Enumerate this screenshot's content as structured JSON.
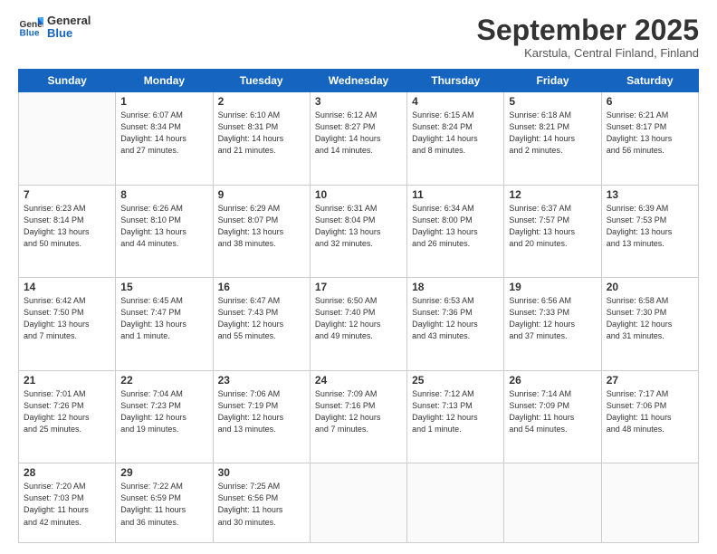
{
  "logo": {
    "general": "General",
    "blue": "Blue"
  },
  "header": {
    "title": "September 2025",
    "subtitle": "Karstula, Central Finland, Finland"
  },
  "weekdays": [
    "Sunday",
    "Monday",
    "Tuesday",
    "Wednesday",
    "Thursday",
    "Friday",
    "Saturday"
  ],
  "weeks": [
    [
      {
        "day": "",
        "text": ""
      },
      {
        "day": "1",
        "text": "Sunrise: 6:07 AM\nSunset: 8:34 PM\nDaylight: 14 hours\nand 27 minutes."
      },
      {
        "day": "2",
        "text": "Sunrise: 6:10 AM\nSunset: 8:31 PM\nDaylight: 14 hours\nand 21 minutes."
      },
      {
        "day": "3",
        "text": "Sunrise: 6:12 AM\nSunset: 8:27 PM\nDaylight: 14 hours\nand 14 minutes."
      },
      {
        "day": "4",
        "text": "Sunrise: 6:15 AM\nSunset: 8:24 PM\nDaylight: 14 hours\nand 8 minutes."
      },
      {
        "day": "5",
        "text": "Sunrise: 6:18 AM\nSunset: 8:21 PM\nDaylight: 14 hours\nand 2 minutes."
      },
      {
        "day": "6",
        "text": "Sunrise: 6:21 AM\nSunset: 8:17 PM\nDaylight: 13 hours\nand 56 minutes."
      }
    ],
    [
      {
        "day": "7",
        "text": "Sunrise: 6:23 AM\nSunset: 8:14 PM\nDaylight: 13 hours\nand 50 minutes."
      },
      {
        "day": "8",
        "text": "Sunrise: 6:26 AM\nSunset: 8:10 PM\nDaylight: 13 hours\nand 44 minutes."
      },
      {
        "day": "9",
        "text": "Sunrise: 6:29 AM\nSunset: 8:07 PM\nDaylight: 13 hours\nand 38 minutes."
      },
      {
        "day": "10",
        "text": "Sunrise: 6:31 AM\nSunset: 8:04 PM\nDaylight: 13 hours\nand 32 minutes."
      },
      {
        "day": "11",
        "text": "Sunrise: 6:34 AM\nSunset: 8:00 PM\nDaylight: 13 hours\nand 26 minutes."
      },
      {
        "day": "12",
        "text": "Sunrise: 6:37 AM\nSunset: 7:57 PM\nDaylight: 13 hours\nand 20 minutes."
      },
      {
        "day": "13",
        "text": "Sunrise: 6:39 AM\nSunset: 7:53 PM\nDaylight: 13 hours\nand 13 minutes."
      }
    ],
    [
      {
        "day": "14",
        "text": "Sunrise: 6:42 AM\nSunset: 7:50 PM\nDaylight: 13 hours\nand 7 minutes."
      },
      {
        "day": "15",
        "text": "Sunrise: 6:45 AM\nSunset: 7:47 PM\nDaylight: 13 hours\nand 1 minute."
      },
      {
        "day": "16",
        "text": "Sunrise: 6:47 AM\nSunset: 7:43 PM\nDaylight: 12 hours\nand 55 minutes."
      },
      {
        "day": "17",
        "text": "Sunrise: 6:50 AM\nSunset: 7:40 PM\nDaylight: 12 hours\nand 49 minutes."
      },
      {
        "day": "18",
        "text": "Sunrise: 6:53 AM\nSunset: 7:36 PM\nDaylight: 12 hours\nand 43 minutes."
      },
      {
        "day": "19",
        "text": "Sunrise: 6:56 AM\nSunset: 7:33 PM\nDaylight: 12 hours\nand 37 minutes."
      },
      {
        "day": "20",
        "text": "Sunrise: 6:58 AM\nSunset: 7:30 PM\nDaylight: 12 hours\nand 31 minutes."
      }
    ],
    [
      {
        "day": "21",
        "text": "Sunrise: 7:01 AM\nSunset: 7:26 PM\nDaylight: 12 hours\nand 25 minutes."
      },
      {
        "day": "22",
        "text": "Sunrise: 7:04 AM\nSunset: 7:23 PM\nDaylight: 12 hours\nand 19 minutes."
      },
      {
        "day": "23",
        "text": "Sunrise: 7:06 AM\nSunset: 7:19 PM\nDaylight: 12 hours\nand 13 minutes."
      },
      {
        "day": "24",
        "text": "Sunrise: 7:09 AM\nSunset: 7:16 PM\nDaylight: 12 hours\nand 7 minutes."
      },
      {
        "day": "25",
        "text": "Sunrise: 7:12 AM\nSunset: 7:13 PM\nDaylight: 12 hours\nand 1 minute."
      },
      {
        "day": "26",
        "text": "Sunrise: 7:14 AM\nSunset: 7:09 PM\nDaylight: 11 hours\nand 54 minutes."
      },
      {
        "day": "27",
        "text": "Sunrise: 7:17 AM\nSunset: 7:06 PM\nDaylight: 11 hours\nand 48 minutes."
      }
    ],
    [
      {
        "day": "28",
        "text": "Sunrise: 7:20 AM\nSunset: 7:03 PM\nDaylight: 11 hours\nand 42 minutes."
      },
      {
        "day": "29",
        "text": "Sunrise: 7:22 AM\nSunset: 6:59 PM\nDaylight: 11 hours\nand 36 minutes."
      },
      {
        "day": "30",
        "text": "Sunrise: 7:25 AM\nSunset: 6:56 PM\nDaylight: 11 hours\nand 30 minutes."
      },
      {
        "day": "",
        "text": ""
      },
      {
        "day": "",
        "text": ""
      },
      {
        "day": "",
        "text": ""
      },
      {
        "day": "",
        "text": ""
      }
    ]
  ]
}
